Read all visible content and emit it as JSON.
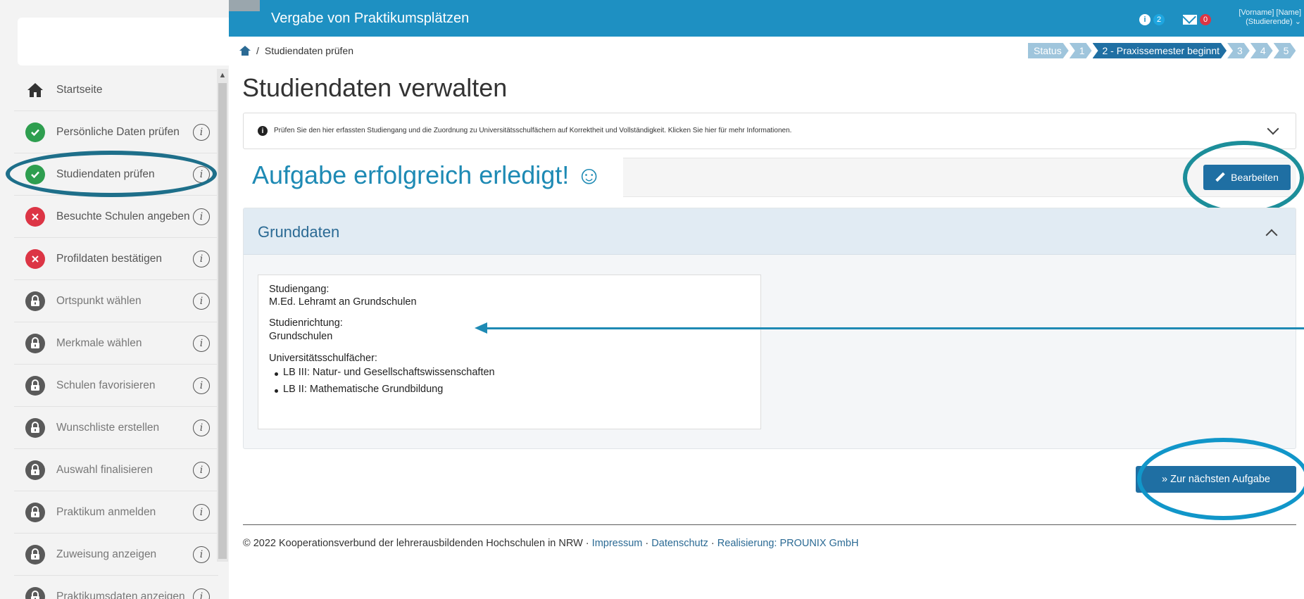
{
  "header": {
    "title": "Vergabe von Praktikumsplätzen",
    "info_count": "2",
    "mail_count": "0",
    "user_line1": "[Vorname] [Name]",
    "user_line2": "(Studierende)",
    "info_badge_color": "#1ea6e0",
    "mail_badge_color": "#dc3545"
  },
  "breadcrumb": {
    "separator": "/",
    "current": "Studiendaten prüfen"
  },
  "stepper": {
    "steps": [
      "Status",
      "1",
      "2 - Praxissemester beginnt",
      "3",
      "4",
      "5"
    ],
    "active_index": 2
  },
  "sidebar": {
    "items": [
      {
        "label": "Startseite",
        "state": "home",
        "icon": "home-icon"
      },
      {
        "label": "Persönliche Daten prüfen",
        "state": "done",
        "icon": "check-icon"
      },
      {
        "label": "Studiendaten prüfen",
        "state": "done",
        "icon": "check-icon"
      },
      {
        "label": "Besuchte Schulen angeben",
        "state": "error",
        "icon": "x-icon"
      },
      {
        "label": "Profildaten bestätigen",
        "state": "error",
        "icon": "x-icon"
      },
      {
        "label": "Ortspunkt wählen",
        "state": "locked",
        "icon": "lock-icon"
      },
      {
        "label": "Merkmale wählen",
        "state": "locked",
        "icon": "lock-icon"
      },
      {
        "label": "Schulen favorisieren",
        "state": "locked",
        "icon": "lock-icon"
      },
      {
        "label": "Wunschliste erstellen",
        "state": "locked",
        "icon": "lock-icon"
      },
      {
        "label": "Auswahl finalisieren",
        "state": "locked",
        "icon": "lock-icon"
      },
      {
        "label": "Praktikum anmelden",
        "state": "locked",
        "icon": "lock-icon"
      },
      {
        "label": "Zuweisung anzeigen",
        "state": "locked",
        "icon": "lock-icon"
      },
      {
        "label": "Praktikumsdaten anzeigen",
        "state": "locked",
        "icon": "lock-icon"
      }
    ],
    "info_glyph": "i"
  },
  "main": {
    "title": "Studiendaten verwalten",
    "info_text": "Prüfen Sie den hier erfassten Studiengang und die Zuordnung zu Universitätsschulfächern auf Korrektheit und Vollständigkeit. Klicken Sie hier für mehr Informationen.",
    "success_message": "Aufgabe erfolgreich erledigt! ☺",
    "edit_button": "Bearbeiten",
    "panel_title": "Grunddaten",
    "studiengang_label": "Studiengang:",
    "studiengang_value": "M.Ed. Lehramt an Grundschulen",
    "studienrichtung_label": "Studienrichtung:",
    "studienrichtung_value": "Grundschulen",
    "faecher_label": "Universitätsschulfächer:",
    "faecher": [
      "LB III: Natur- und Gesellschaftswissenschaften",
      "LB II: Mathematische Grundbildung"
    ],
    "next_button": "» Zur nächsten Aufgabe"
  },
  "footer": {
    "copyright": "© 2022 Kooperationsverbund der lehrerausbildenden Hochschulen in NRW",
    "sep": " · ",
    "impressum": "Impressum",
    "datenschutz": "Datenschutz",
    "realisierung": "Realisierung: PROUNIX GmbH"
  }
}
